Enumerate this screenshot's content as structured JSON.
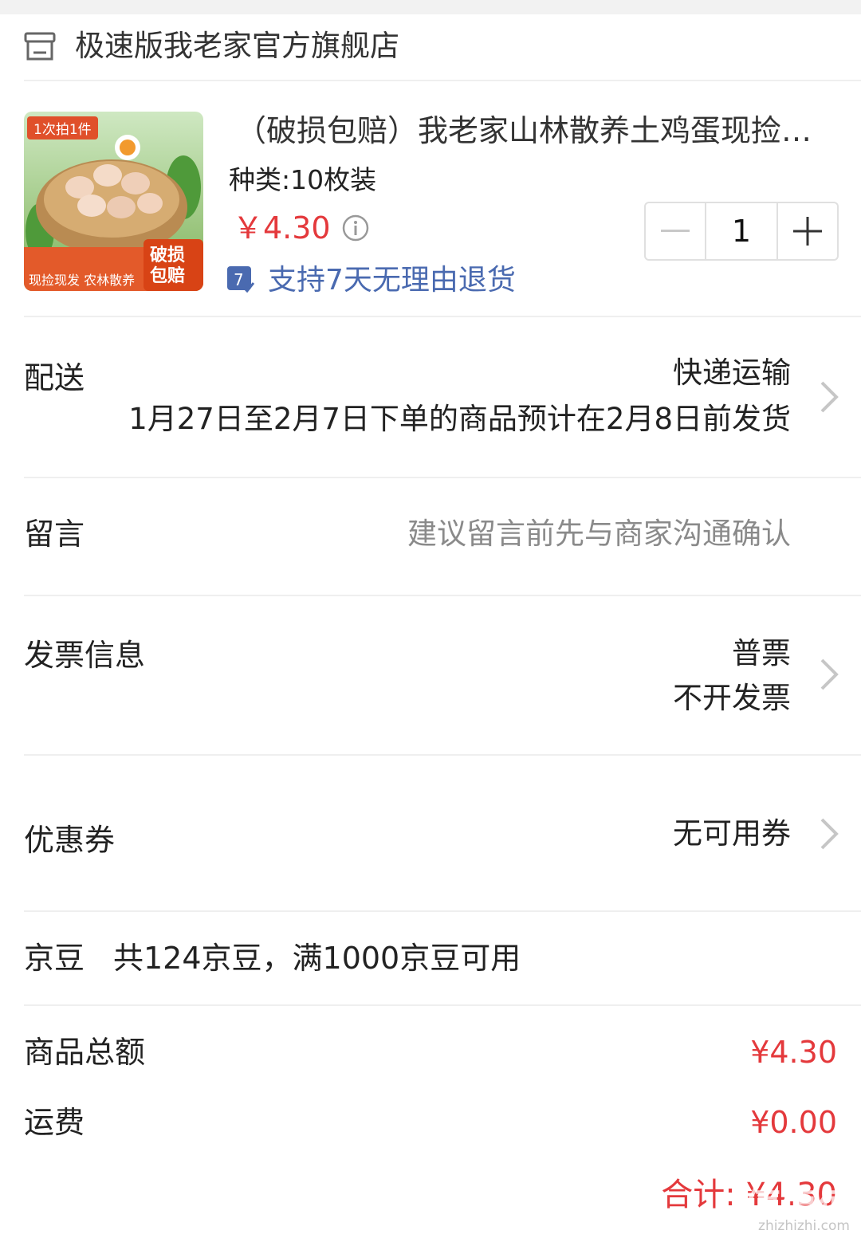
{
  "shop": {
    "name": "极速版我老家官方旗舰店",
    "icon": "store-icon"
  },
  "product": {
    "image_tag": "1次拍1件",
    "image_badge": "破损包赔",
    "image_bottom_text": "现捡现发 农林散养",
    "title": "（破损包赔）我老家山林散养土鸡蛋现捡新鲜柴鸡蛋",
    "spec": "种类:10枚装",
    "price": "￥4.30",
    "quantity": "1",
    "return_badge_text": "7",
    "return_policy": "支持7天无理由退货"
  },
  "delivery": {
    "label": "配送",
    "method": "快递运输",
    "note": "1月27日至2月7日下单的商品预计在2月8日前发货"
  },
  "message": {
    "label": "留言",
    "placeholder": "建议留言前先与商家沟通确认"
  },
  "invoice": {
    "label": "发票信息",
    "type": "普票",
    "value": "不开发票"
  },
  "coupon": {
    "label": "优惠券",
    "value": "无可用券"
  },
  "jingdou": {
    "label": "京豆",
    "info": "共124京豆，满1000京豆可用"
  },
  "summary": {
    "goods_total_label": "商品总额",
    "goods_total": "¥4.30",
    "shipping_label": "运费",
    "shipping": "¥0.00",
    "total": "合计: ¥4.30"
  },
  "watermark": {
    "main": "值值值",
    "sub": "zhizhizhi.com"
  },
  "colors": {
    "price": "#e4393c",
    "link_blue": "#4a6ab0",
    "gray_text": "#8a8a8a"
  }
}
